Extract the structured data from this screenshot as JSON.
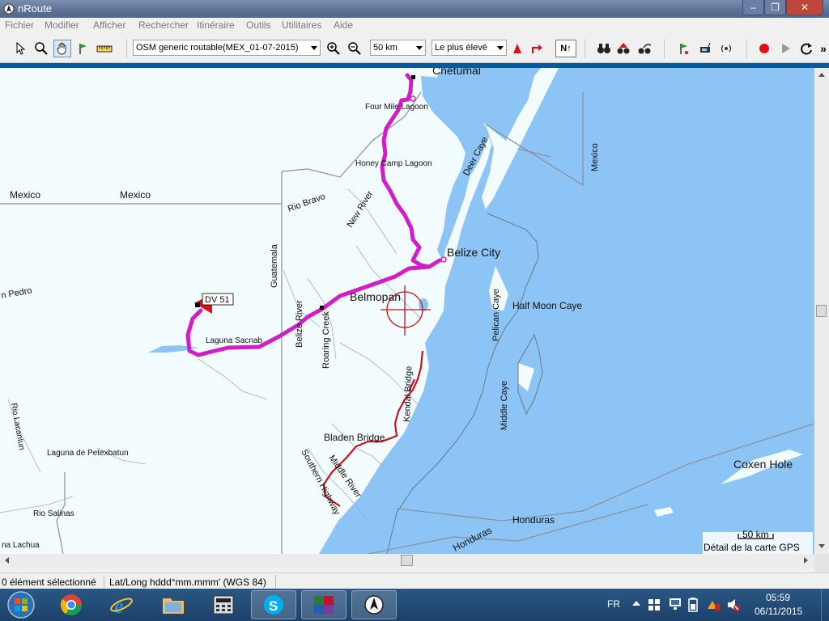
{
  "window": {
    "title": "nRoute",
    "minimize": "–",
    "maximize": "❐",
    "close": "✕"
  },
  "menu": [
    "Fichier",
    "Modifier",
    "Afficher",
    "Rechercher",
    "Itinéraire",
    "Outils",
    "Utilitaires",
    "Aide"
  ],
  "toolbar": {
    "map_product": "OSM generic routable(MEX_01-07-2015)",
    "zoom_scale": "50 km",
    "detail_level": "Le plus élevé",
    "north_up": "N↑"
  },
  "map": {
    "labels": {
      "chetumal": "Chetumal",
      "four_mile_lagoon": "Four Mile Lagoon",
      "honey_camp": "Honey Camp Lagoon",
      "deer_caye": "Deer Caye",
      "mexico_east": "Mexico",
      "mexico_w1": "Mexico",
      "mexico_w2": "Mexico",
      "rio_bravo": "Rio Bravo",
      "new_river": "New River",
      "guatemala": "Guatemala",
      "belize_city": "Belize City",
      "san_pedro": "n Pedro",
      "waypoint": "DV 51",
      "belmopan": "Belmopan",
      "half_moon_caye": "Half Moon Caye",
      "pelican_caye": "Pelican Caye",
      "belize_river": "Belize River",
      "roaring_creek": "Roaring Creek",
      "laguna_sacnab": "Laguna Sacnab",
      "kendal_bridge": "Kendal Bridge",
      "middle_caye": "Middle Caye",
      "rio_lacantun": "Rio Lacantun",
      "laguna_petexbatun": "Laguna de Petexbatun",
      "bladen_bridge": "Bladen Bridge",
      "middle_river": "Middle River",
      "southern_highway": "Southern Highway",
      "coxen_hole": "Coxen Hole",
      "rio_salinas": "Rio Salinas",
      "honduras_1": "Honduras",
      "honduras_2": "Honduras",
      "laguna_lachua": "na Lachua",
      "scale": "50 km",
      "detail_note": "Détail de la carte GPS"
    }
  },
  "status": {
    "selection": "0 élément sélectionné",
    "coord_format": "Lat/Long hddd°mm.mmm' (WGS 84)"
  },
  "taskbar": {
    "language": "FR",
    "time": "05:59",
    "date": "06/11/2015"
  },
  "colors": {
    "water": "#8cc4f5",
    "land": "#f2fbfd",
    "route": "#d21ec8",
    "road": "#c8141e",
    "cursor": "#cc1111",
    "waypoint_flag": "#e01010"
  }
}
